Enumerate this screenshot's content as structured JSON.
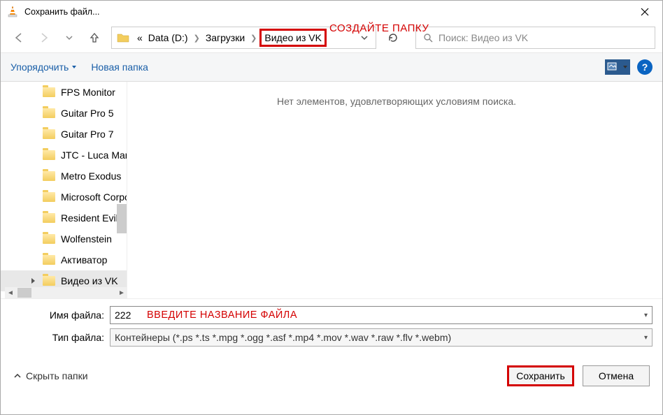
{
  "window": {
    "title": "Сохранить файл..."
  },
  "annotations": {
    "create_folder": "СОЗДАЙТЕ ПАПКУ",
    "enter_filename": "ВВЕДИТЕ НАЗВАНИЕ ФАЙЛА"
  },
  "breadcrumb": {
    "overflow": "«",
    "drive": "Data (D:)",
    "folder1": "Загрузки",
    "current": "Видео из VK"
  },
  "search": {
    "placeholder": "Поиск: Видео из VK"
  },
  "toolbar": {
    "organize": "Упорядочить",
    "new_folder": "Новая папка"
  },
  "tree": {
    "items": [
      {
        "label": "FPS Monitor"
      },
      {
        "label": "Guitar Pro 5"
      },
      {
        "label": "Guitar Pro 7"
      },
      {
        "label": "JTC - Luca Mantovanelli"
      },
      {
        "label": "Metro Exodus"
      },
      {
        "label": "Microsoft Corporation"
      },
      {
        "label": "Resident Evil"
      },
      {
        "label": "Wolfenstein"
      },
      {
        "label": "Активатор"
      },
      {
        "label": "Видео из VK"
      }
    ]
  },
  "main": {
    "empty_text": "Нет элементов, удовлетворяющих условиям поиска."
  },
  "form": {
    "filename_label": "Имя файла:",
    "filename_value": "222",
    "filetype_label": "Тип файла:",
    "filetype_value": "Контейнеры (*.ps *.ts *.mpg *.ogg *.asf *.mp4 *.mov *.wav *.raw *.flv *.webm)"
  },
  "footer": {
    "hide_folders": "Скрыть папки",
    "save": "Сохранить",
    "cancel": "Отмена"
  }
}
